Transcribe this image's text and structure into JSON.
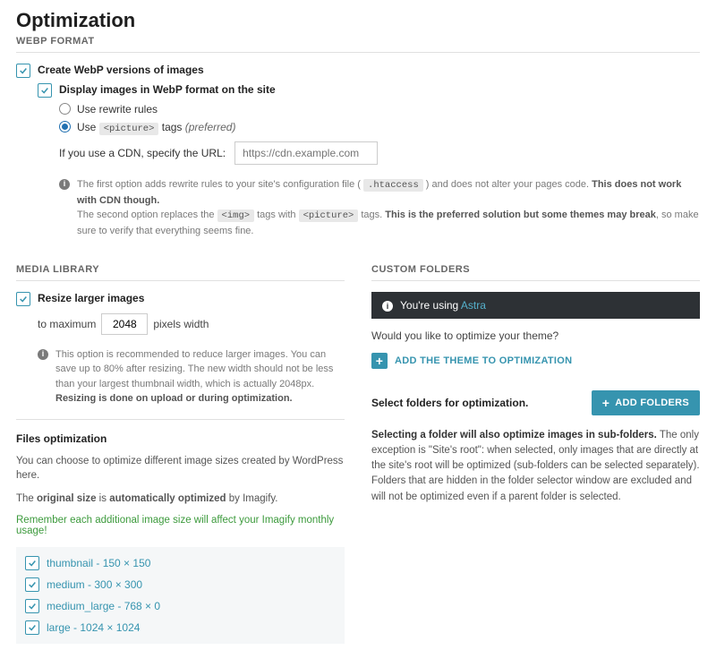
{
  "page": {
    "title": "Optimization"
  },
  "webp": {
    "section": "WEBP FORMAT",
    "create_label": "Create WebP versions of images",
    "display_label": "Display images in WebP format on the site",
    "radios": {
      "rewrite": "Use rewrite rules",
      "picture_pre": "Use ",
      "picture_code": "<picture>",
      "picture_post": " tags ",
      "picture_hint": "(preferred)"
    },
    "cdn_label": "If you use a CDN, specify the URL:",
    "cdn_placeholder": "https://cdn.example.com",
    "info": {
      "line1_pre": "The first option adds rewrite rules to your site's configuration file ( ",
      "line1_code": ".htaccess",
      "line1_mid": " ) and does not alter your pages code. ",
      "line1_bold": "This does not work with CDN though.",
      "line2_pre": "The second option replaces the ",
      "line2_code1": "<img>",
      "line2_mid": " tags with ",
      "line2_code2": "<picture>",
      "line2_post": " tags. ",
      "line2_bold": "This is the preferred solution but some themes may break",
      "line2_tail": ", so make sure to verify that everything seems fine."
    }
  },
  "media": {
    "section": "MEDIA LIBRARY",
    "resize_label": "Resize larger images",
    "max_pre": "to maximum",
    "max_value": "2048",
    "max_post": "pixels width",
    "info_pre": "This option is recommended to reduce larger images. You can save up to 80% after resizing. The new width should not be less than your largest thumbnail width, which is actually 2048px. ",
    "info_bold": "Resizing is done on upload or during optimization."
  },
  "files": {
    "heading": "Files optimization",
    "desc": "You can choose to optimize different image sizes created by WordPress here.",
    "auto_pre": "The ",
    "auto_b1": "original size",
    "auto_mid": " is ",
    "auto_b2": "automatically optimized",
    "auto_post": " by Imagify.",
    "green": "Remember each additional image size will affect your Imagify monthly usage!",
    "sizes": [
      "thumbnail - 150 × 150",
      "medium - 300 × 300",
      "medium_large - 768 × 0",
      "large - 1024 × 1024"
    ]
  },
  "custom": {
    "section": "CUSTOM FOLDERS",
    "banner_pre": "You're using ",
    "banner_theme": "Astra",
    "prompt": "Would you like to optimize your theme?",
    "add_theme": "ADD THE THEME TO OPTIMIZATION",
    "select_label": "Select folders for optimization.",
    "add_folders": "ADD FOLDERS",
    "desc_b": "Selecting a folder will also optimize images in sub-folders.",
    "desc_1": " The only exception is \"Site's root\": when selected, only images that are directly at the site's root will be optimized (sub-folders can be selected separately).",
    "desc_2": "Folders that are hidden in the folder selector window are excluded and will not be optimized even if a parent folder is selected."
  }
}
